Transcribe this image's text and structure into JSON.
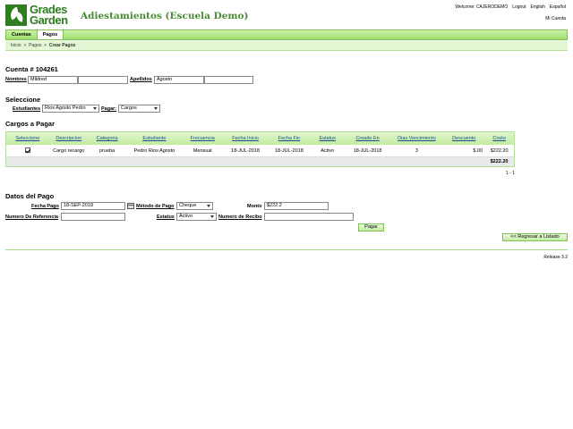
{
  "header": {
    "logo_line1": "Grades",
    "logo_line2": "Garden",
    "title": "Adiestamientos (Escuela Demo)",
    "welcome": "Welcome: CAJERODEMO",
    "logout": "Logout",
    "english": "English",
    "espanol": "Español",
    "mi_cuenta": "Mi Cuenta"
  },
  "nav": {
    "tabs": [
      "Cuentas",
      "Pagos"
    ],
    "breadcrumb": [
      "Inicio",
      "Pagos",
      "Crear Pagos"
    ]
  },
  "account": {
    "title": "Cuenta # 104261",
    "nombres_label": "Nombres",
    "nombres": "Mildred",
    "apellidos_label": "Apellidos",
    "apellidos": "Agosto"
  },
  "seleccione": {
    "title": "Seleccione",
    "estudiantes_label": "Estudiantes",
    "estudiante": "Rios Agosto Pedro",
    "pagar_label": "Pagar:",
    "pagar": "Cargos"
  },
  "cargos": {
    "title": "Cargos a Pagar",
    "headers": [
      "Seleccione",
      "Descripcion",
      "Categoria",
      "Estudiante",
      "Frecuencia",
      "Fecha Inicio",
      "Fecha Fin",
      "Estatus",
      "Creado En",
      "Dias Vencimiento",
      "Descuento",
      "Costo"
    ],
    "rows": [
      [
        "",
        "Cargo recargo",
        "prueba",
        "Pedro Rios Agosto",
        "Mensual",
        "18-JUL-2018",
        "18-JUL-2018",
        "Activo",
        "18-JUL-2018",
        "3",
        "$.00",
        "$222.20"
      ]
    ],
    "total": "$222.20",
    "pager": "1 - 1"
  },
  "pago": {
    "title": "Datos del Pago",
    "fecha_label": "Fecha Pago",
    "fecha": "18-SEP-2018",
    "metodo_label": "Método de Pago",
    "metodo": "Cheque",
    "monto_label": "Monto",
    "monto": "$222.2",
    "referencia_label": "Numero De Referencia",
    "referencia": "",
    "estatus_label": "Estatus",
    "estatus": "Activo",
    "recibo_label": "Numero de Recibo",
    "recibo": "",
    "pagar_button": "Pagar",
    "regresar_button": "<< Regresar a Listado"
  },
  "footer": {
    "release": "Release 3.2"
  },
  "colors": {
    "brand_green": "#2e7d1e",
    "title_green": "#4a8a36",
    "nav_green": "#9fdf6d"
  }
}
